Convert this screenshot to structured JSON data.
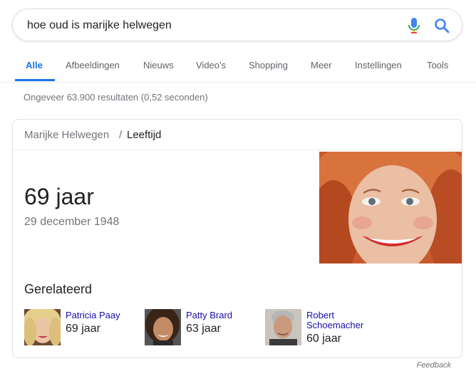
{
  "search": {
    "query": "hoe oud is marijke helwegen",
    "mic_icon": "mic-icon",
    "search_icon": "search-icon"
  },
  "tabs": [
    {
      "label": "Alle",
      "active": true
    },
    {
      "label": "Afbeeldingen"
    },
    {
      "label": "Nieuws"
    },
    {
      "label": "Video's"
    },
    {
      "label": "Shopping"
    },
    {
      "label": "Meer"
    },
    {
      "label": "Instellingen"
    },
    {
      "label": "Tools"
    }
  ],
  "result_stats": "Ongeveer 63.900 resultaten (0,52 seconden)",
  "card": {
    "breadcrumb": {
      "entity": "Marijke Helwegen",
      "separator": "/",
      "attribute": "Leeftijd"
    },
    "age": "69 jaar",
    "birth_date": "29 december 1948",
    "related_heading": "Gerelateerd",
    "related": [
      {
        "name": "Patricia Paay",
        "age": "69 jaar"
      },
      {
        "name": "Patty Brard",
        "age": "63 jaar"
      },
      {
        "name_line1": "Robert",
        "name_line2": "Schoemacher",
        "age": "60 jaar"
      }
    ]
  },
  "feedback": "Feedback",
  "colors": {
    "accent": "#1a73e8",
    "link": "#1a0dab",
    "muted": "#70757a"
  }
}
